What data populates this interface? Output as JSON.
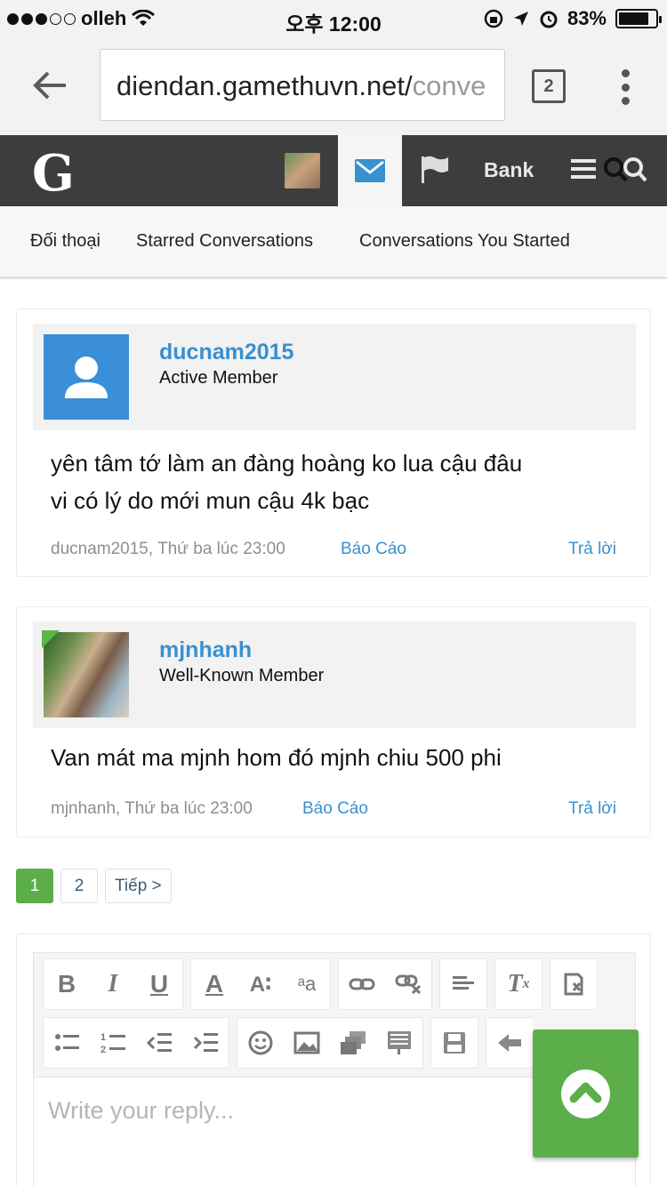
{
  "status_bar": {
    "carrier": "olleh",
    "time": "오후 12:00",
    "battery": "83%",
    "battery_level": 0.83
  },
  "browser": {
    "url_main": "diendan.gamethuvn.net/",
    "url_faded": "conve",
    "tab_count": "2"
  },
  "site_nav": {
    "logo": "G",
    "bank_label": "Bank"
  },
  "tabs": [
    {
      "label": "Đối thoại"
    },
    {
      "label": "Starred Conversations"
    },
    {
      "label": "Conversations You Started"
    }
  ],
  "messages": [
    {
      "username": "ducnam2015",
      "role": "Active Member",
      "lines": [
        "yên tâm tớ làm an đàng hoàng ko lua cậu đâu",
        "vi có lý do mới mun cậu 4k bạc"
      ],
      "meta": "ducnam2015, Thứ ba lúc 23:00",
      "report": "Báo Cáo",
      "reply": "Trả lời"
    },
    {
      "username": "mjnhanh",
      "role": "Well-Known Member",
      "lines": [
        "Van mát ma mjnh hom đó mjnh chiu 500 phi"
      ],
      "meta": "mjnhanh, Thứ ba lúc 23:00",
      "report": "Báo Cáo",
      "reply": "Trả lời"
    }
  ],
  "pagination": {
    "pages": [
      "1",
      "2"
    ],
    "current": "1",
    "next": "Tiếp >"
  },
  "editor": {
    "placeholder": "Write your reply...",
    "toolbar_row1": [
      "bold-icon",
      "italic-icon",
      "underline-icon",
      "text-color-icon",
      "font-size-icon",
      "text-smaller-icon",
      "link-icon",
      "unlink-icon",
      "align-icon",
      "remove-format-icon",
      "paste-icon"
    ],
    "toolbar_row2": [
      "bullet-list-icon",
      "numbered-list-icon",
      "outdent-icon",
      "indent-icon",
      "smilie-icon",
      "image-icon",
      "media-icon",
      "quote-icon",
      "save-draft-icon",
      "undo-icon"
    ]
  },
  "colors": {
    "accent_blue": "#3990cf",
    "nav_dark": "#3d3d3d",
    "green": "#5bae4a"
  }
}
